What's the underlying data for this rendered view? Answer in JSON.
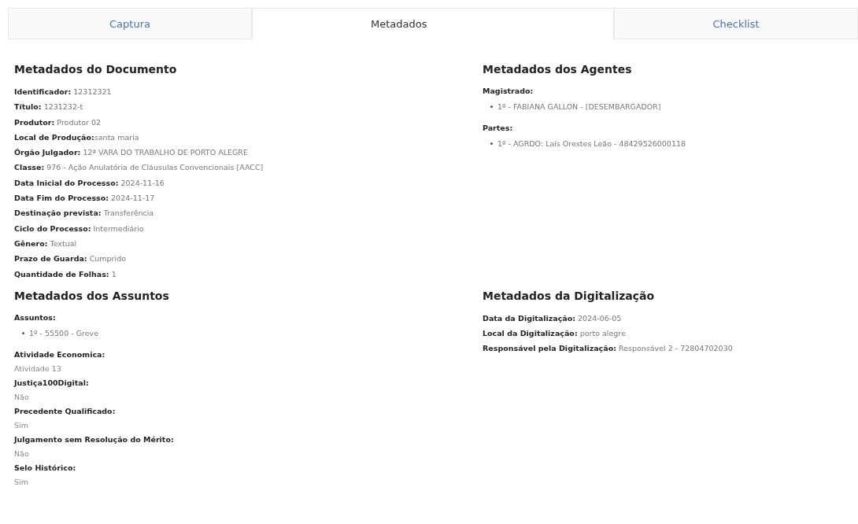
{
  "tabs": [
    {
      "label": "Captura",
      "selected": false
    },
    {
      "label": "Metadados",
      "selected": true
    },
    {
      "label": "Checklist",
      "selected": false
    }
  ],
  "sections": [
    {
      "title": "Metadados do Documento",
      "blocks": [
        {
          "kind": "inline",
          "text": "**Identificador:** 12312321"
        },
        {
          "kind": "inline",
          "text": "**Título:** 1231232-t"
        },
        {
          "kind": "inline",
          "text": "**Produtor:** Produtor 02"
        },
        {
          "kind": "inline",
          "text": "**Local de Produção:**santa maria"
        },
        {
          "kind": "inline",
          "text": "**Órgão Julgador:** 12ª VARA DO TRABALHO DE PORTO ALEGRE"
        },
        {
          "kind": "inline",
          "text": "**Classe:** 976 - Ação Anulatória de Cláusulas Convencionais [AACC]"
        },
        {
          "kind": "inline",
          "text": "**Data Inicial do Processo:** 2024-11-16"
        },
        {
          "kind": "inline",
          "text": "**Data Fim do Processo:** 2024-11-17"
        },
        {
          "kind": "inline",
          "text": "**Destinação prevista:** Transferência"
        },
        {
          "kind": "inline",
          "text": "**Ciclo do Processo:** Intermediário"
        },
        {
          "kind": "inline",
          "text": "**Gênero:** Textual"
        },
        {
          "kind": "inline",
          "text": "**Prazo de Guarda:** Cumprido"
        },
        {
          "kind": "inline",
          "text": "**Quantidade de Folhas:** 1"
        }
      ]
    },
    {
      "title": "Metadados dos Agentes",
      "blocks": [
        {
          "kind": "list",
          "label": "Magistrado:",
          "items": [
            "1º - FABIANA GALLON - [DESEMBARGADOR]"
          ]
        },
        {
          "kind": "list",
          "label": "Partes:",
          "items": [
            "1º - AGRDO: Laís Orestes Leão - 48429526000118"
          ]
        }
      ]
    },
    {
      "title": "Metadados dos Assuntos",
      "blocks": [
        {
          "kind": "list",
          "label": "Assuntos:",
          "items": [
            "1º - 55500 - Greve"
          ]
        },
        {
          "kind": "stacked",
          "label": "Atividade Economica:",
          "value": "Atividade 13"
        },
        {
          "kind": "stacked",
          "label": "Justiça100Digital:",
          "value": "Não"
        },
        {
          "kind": "stacked",
          "label": "Precedente Qualificado:",
          "value": "Sim"
        },
        {
          "kind": "stacked",
          "label": "Julgamento sem Resolução do Mérito:",
          "value": "Não"
        },
        {
          "kind": "stacked",
          "label": "Selo Histórico:",
          "value": "Sim"
        }
      ]
    },
    {
      "title": "Metadados da Digitalização",
      "blocks": [
        {
          "kind": "inline",
          "text": "**Data da Digitalização:** 2024-06-05"
        },
        {
          "kind": "inline",
          "text": "**Local da Digitalização:** porto alegre"
        },
        {
          "kind": "inline",
          "text": "**Responsável pela Digitalização:** Responsável 2 - 72804702030"
        }
      ]
    }
  ]
}
